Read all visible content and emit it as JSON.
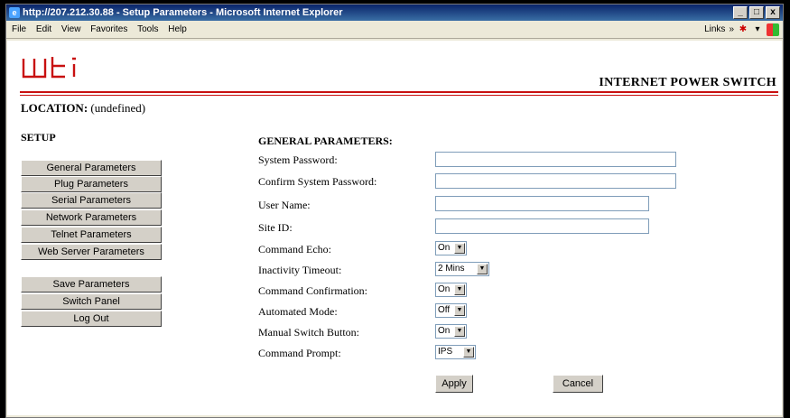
{
  "window": {
    "title": "http://207.212.30.88 - Setup Parameters - Microsoft Internet Explorer",
    "ie_icon": "ie-logo-icon",
    "controls": [
      "_",
      "□",
      "x"
    ]
  },
  "menubar": {
    "items": [
      "File",
      "Edit",
      "View",
      "Favorites",
      "Tools",
      "Help"
    ],
    "links_label": "Links",
    "chevron": "»"
  },
  "header": {
    "logo_text": "wti",
    "product": "INTERNET POWER SWITCH",
    "rule_color": "#c81010"
  },
  "location": {
    "label": "LOCATION:",
    "value": "(undefined)"
  },
  "sidebar": {
    "title": "SETUP",
    "group1": [
      "General Parameters",
      "Plug Parameters",
      "Serial Parameters",
      "Network Parameters",
      "Telnet Parameters",
      "Web Server Parameters"
    ],
    "group2": [
      "Save Parameters",
      "Switch Panel",
      "Log Out"
    ]
  },
  "form": {
    "title": "GENERAL PARAMETERS:",
    "fields": {
      "system_password": {
        "label": "System Password:",
        "value": ""
      },
      "confirm_password": {
        "label": "Confirm System Password:",
        "value": ""
      },
      "user_name": {
        "label": "User Name:",
        "value": ""
      },
      "site_id": {
        "label": "Site ID:",
        "value": ""
      },
      "command_echo": {
        "label": "Command Echo:",
        "value": "On"
      },
      "inactivity_timeout": {
        "label": "Inactivity Timeout:",
        "value": "2 Mins"
      },
      "command_confirmation": {
        "label": "Command Confirmation:",
        "value": "On"
      },
      "automated_mode": {
        "label": "Automated Mode:",
        "value": "Off"
      },
      "manual_switch_button": {
        "label": "Manual Switch Button:",
        "value": "On"
      },
      "command_prompt": {
        "label": "Command Prompt:",
        "value": "IPS"
      }
    },
    "apply_label": "Apply",
    "cancel_label": "Cancel"
  }
}
